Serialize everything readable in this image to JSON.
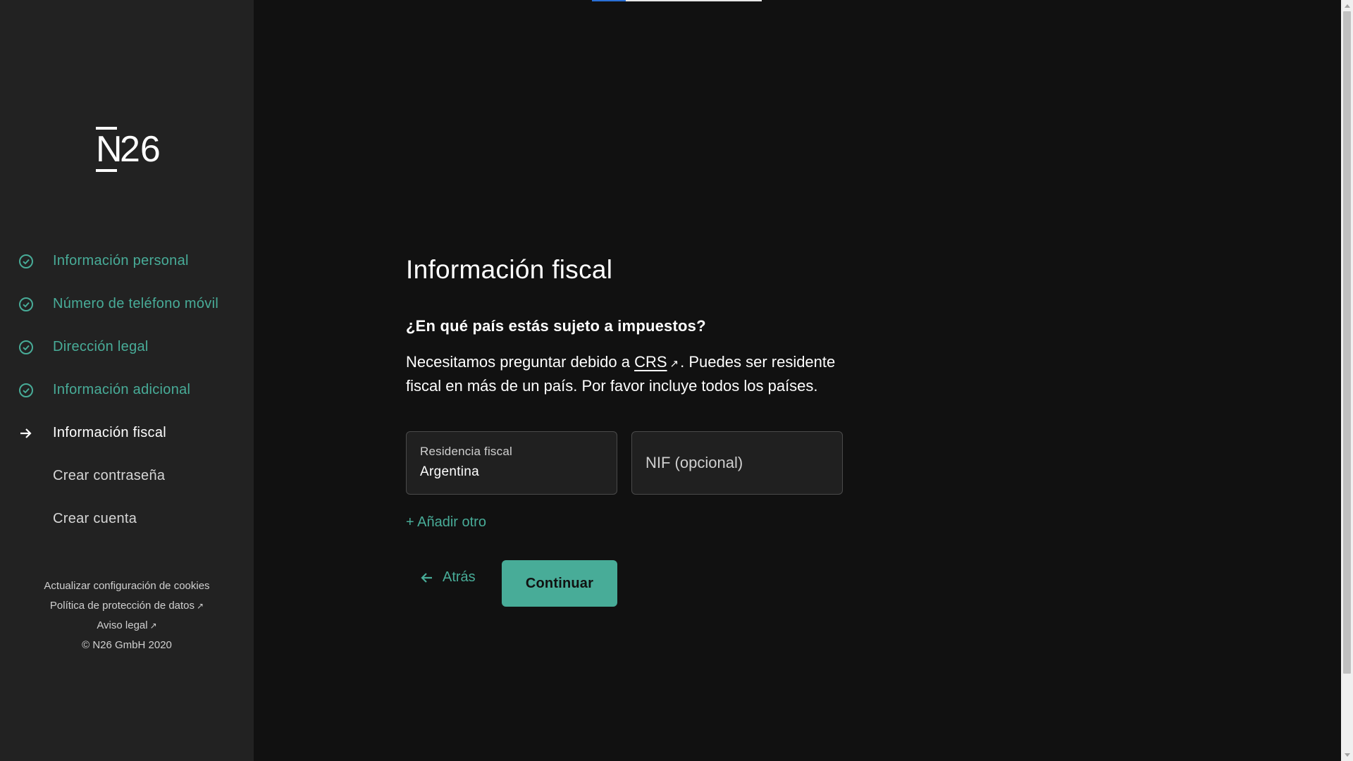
{
  "brand": {
    "logo_n": "N",
    "logo_num": "26"
  },
  "sidebar": {
    "steps": [
      {
        "label": "Información personal",
        "state": "done",
        "icon": "check-circle-icon"
      },
      {
        "label": "Número de teléfono móvil",
        "state": "done",
        "icon": "check-circle-icon"
      },
      {
        "label": "Dirección legal",
        "state": "done",
        "icon": "check-circle-icon"
      },
      {
        "label": "Información adicional",
        "state": "done",
        "icon": "check-circle-icon"
      },
      {
        "label": "Información fiscal",
        "state": "active",
        "icon": "arrow-right-icon"
      },
      {
        "label": "Crear contraseña",
        "state": "todo"
      },
      {
        "label": "Crear cuenta",
        "state": "todo"
      }
    ],
    "footer": {
      "cookies": "Actualizar configuración de cookies",
      "privacy": "Política de protección de datos",
      "legal": "Aviso legal",
      "copyright": "© N26 GmbH 2020"
    }
  },
  "progress": {
    "fraction": 0.2
  },
  "main": {
    "title": "Información fiscal",
    "question": "¿En qué país estás sujeto a impuestos?",
    "desc_before": "Necesitamos preguntar debido a ",
    "desc_link": "CRS",
    "desc_after": ". Puedes ser residente fiscal en más de un país. Por favor incluye todos los países.",
    "residence_label": "Residencia fiscal",
    "residence_value": "Argentina",
    "nif_placeholder": "NIF (opcional)",
    "add_other": "+ Añadir otro",
    "back_label": "Atrás",
    "continue_label": "Continuar"
  },
  "colors": {
    "accent": "#48ac98",
    "background": "#111111",
    "sidebar": "#222222",
    "progress": "#2a6fd6"
  }
}
